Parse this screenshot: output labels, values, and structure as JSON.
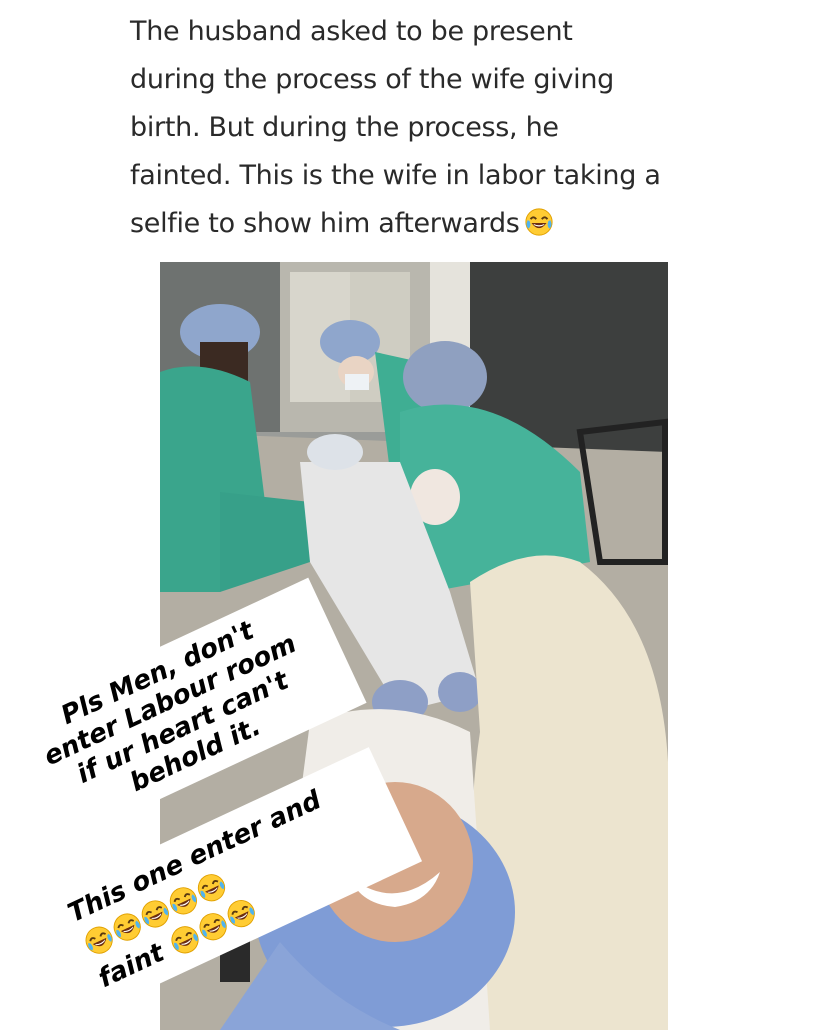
{
  "caption": {
    "lines": [
      "The husband asked to be present",
      "during the process of the wife giving",
      "birth. But during the process, he",
      "fainted. This is the wife in labor taking a",
      "selfie to show him afterwards"
    ],
    "trailing_icon": "face-with-tears-of-joy-icon"
  },
  "sticker_top": {
    "lines": [
      "Pls Men, don't",
      "enter Labour room",
      "if ur heart can't",
      "behold it."
    ]
  },
  "sticker_bottom": {
    "line1": "This one enter and",
    "line2_prefix": "faint",
    "icon": "face-with-tears-of-joy-icon",
    "emoji_count_line1": 5,
    "emoji_count_line2": 3
  }
}
